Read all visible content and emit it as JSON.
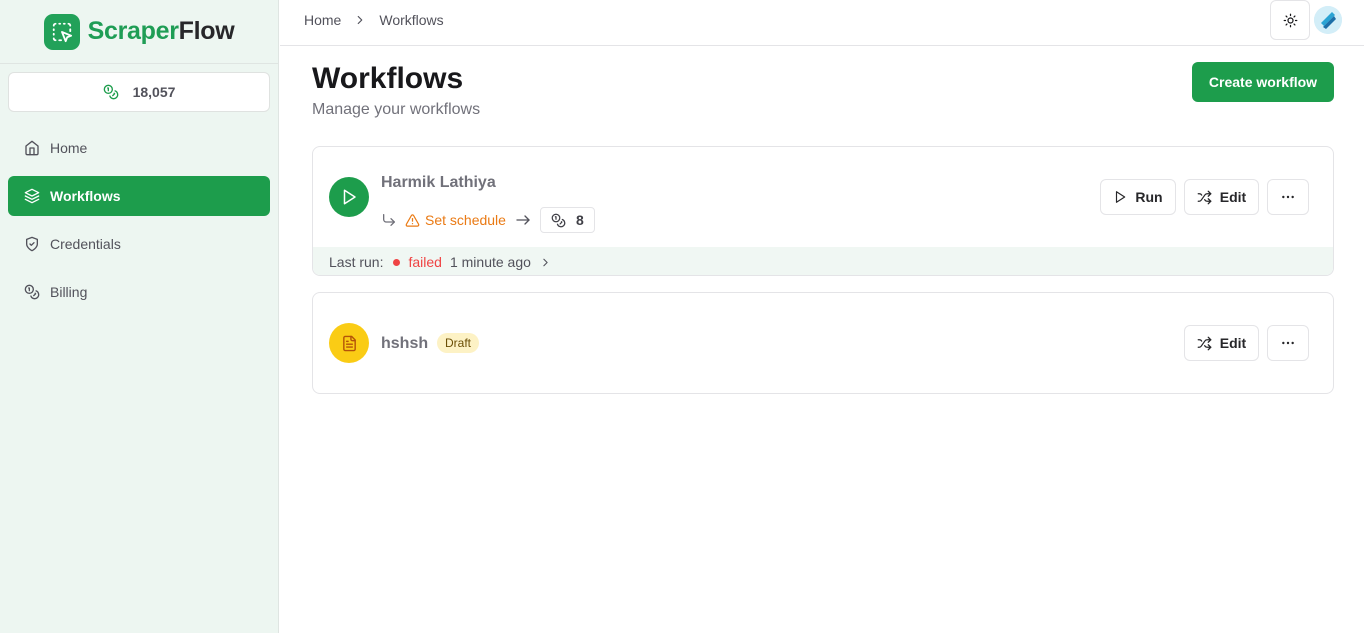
{
  "brand": {
    "name_part1": "Scraper",
    "name_part2": "Flow"
  },
  "credits": {
    "value": "18,057"
  },
  "sidebar": {
    "items": [
      {
        "label": "Home",
        "icon": "home-icon"
      },
      {
        "label": "Workflows",
        "icon": "layers-icon",
        "active": true
      },
      {
        "label": "Credentials",
        "icon": "shield-icon"
      },
      {
        "label": "Billing",
        "icon": "coins-icon"
      }
    ]
  },
  "breadcrumb": {
    "home": "Home",
    "current": "Workflows"
  },
  "header": {
    "title": "Workflows",
    "subtitle": "Manage your workflows",
    "create_label": "Create workflow"
  },
  "workflows": [
    {
      "name": "Harmik Lathiya",
      "status": "published",
      "schedule_label": "Set schedule",
      "credits": "8",
      "run_label": "Run",
      "edit_label": "Edit",
      "last_run_label": "Last run:",
      "last_run_status": "failed",
      "last_run_time": "1 minute ago"
    },
    {
      "name": "hshsh",
      "status": "draft",
      "badge": "Draft",
      "edit_label": "Edit"
    }
  ],
  "colors": {
    "accent": "#1d9d4c",
    "warning": "#ea7a14",
    "error": "#ef4444",
    "draft": "#facc15"
  }
}
